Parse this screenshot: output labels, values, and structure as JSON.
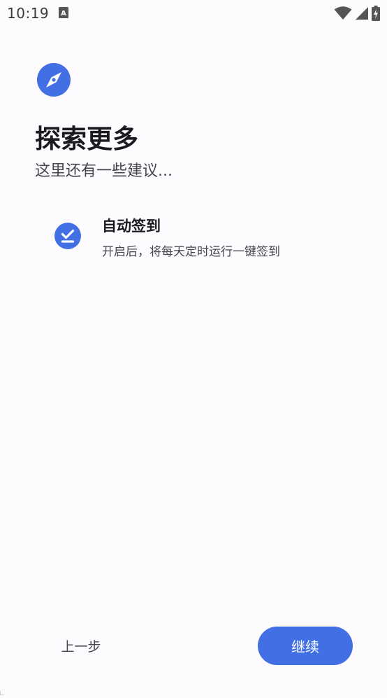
{
  "status_bar": {
    "time": "10:19",
    "notification_icon": "a-letter-icon",
    "wifi_icon": "wifi-icon",
    "signal_icon": "signal-icon",
    "battery_icon": "battery-charging-icon"
  },
  "header": {
    "icon": "compass-icon",
    "title": "探索更多",
    "subtitle": "这里还有一些建议..."
  },
  "suggestions": [
    {
      "icon": "check-circle-icon",
      "title": "自动签到",
      "description": "开启后，将每天定时运行一键签到"
    }
  ],
  "footer": {
    "back_label": "上一步",
    "continue_label": "继续"
  },
  "colors": {
    "accent": "#4270e4",
    "background": "#fefbff",
    "text_primary": "#1b1b1f",
    "text_secondary": "#46464f"
  }
}
